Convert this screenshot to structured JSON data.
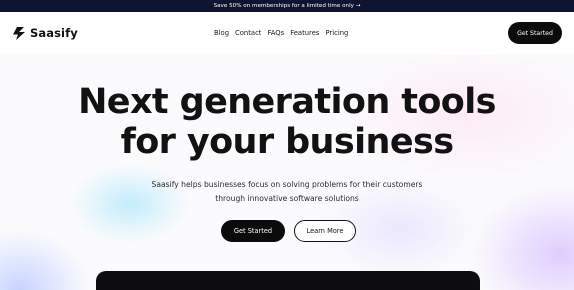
{
  "announcement": {
    "text": "Save 50% on memberships for a limited time only →"
  },
  "brand": {
    "name": "Saasify",
    "logo_icon": "lightning-bolt-icon"
  },
  "nav": {
    "links": [
      "Blog",
      "Contact",
      "FAQs",
      "Features",
      "Pricing"
    ],
    "cta_label": "Get Started"
  },
  "hero": {
    "headline_line1": "Next generation tools",
    "headline_line2": "for your business",
    "subtext_line1": "Saasify helps businesses focus on solving problems for their customers",
    "subtext_line2": "through innovative software solutions",
    "primary_cta": "Get Started",
    "secondary_cta": "Learn More"
  },
  "colors": {
    "announcement_bg": "#0e1330",
    "primary_button": "#0b0b0b",
    "text": "#121212"
  }
}
